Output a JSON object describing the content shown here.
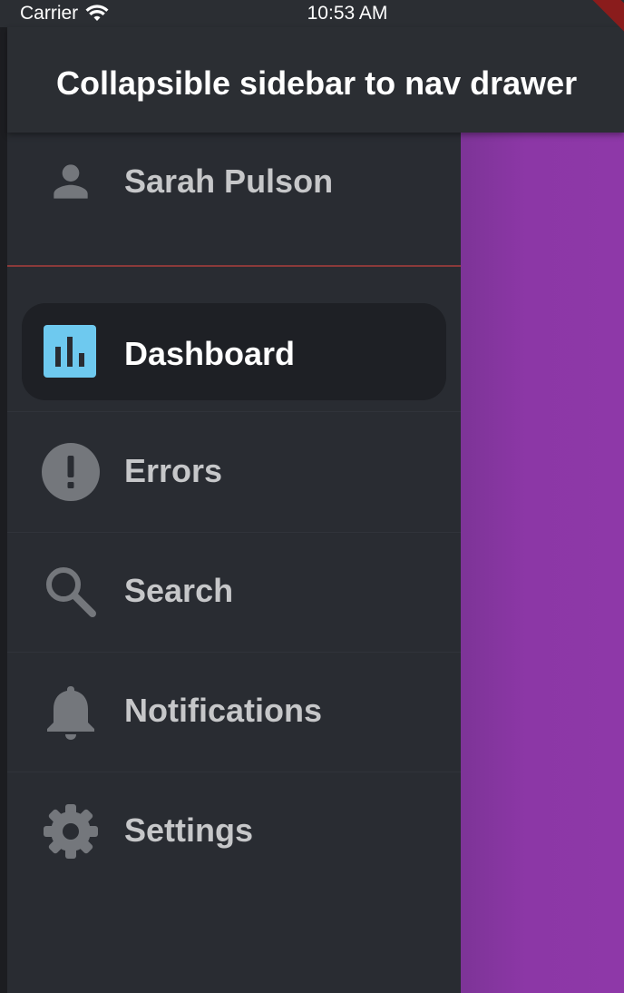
{
  "status_bar": {
    "carrier": "Carrier",
    "time": "10:53 AM"
  },
  "app_bar": {
    "title": "Collapsible sidebar to nav drawer"
  },
  "profile": {
    "name": "Sarah Pulson"
  },
  "nav": {
    "items": [
      {
        "label": "Dashboard",
        "icon": "bar-chart-icon",
        "selected": true
      },
      {
        "label": "Errors",
        "icon": "error-icon",
        "selected": false
      },
      {
        "label": "Search",
        "icon": "search-icon",
        "selected": false
      },
      {
        "label": "Notifications",
        "icon": "bell-icon",
        "selected": false
      },
      {
        "label": "Settings",
        "icon": "gear-icon",
        "selected": false
      }
    ]
  },
  "colors": {
    "sidebar": "#292c32",
    "app_bar": "#2b2e33",
    "content": "#8e38a8",
    "accent_icon": "#6ec9ef",
    "selected_pill": "#1e2025",
    "divider": "#8b3a3a"
  }
}
